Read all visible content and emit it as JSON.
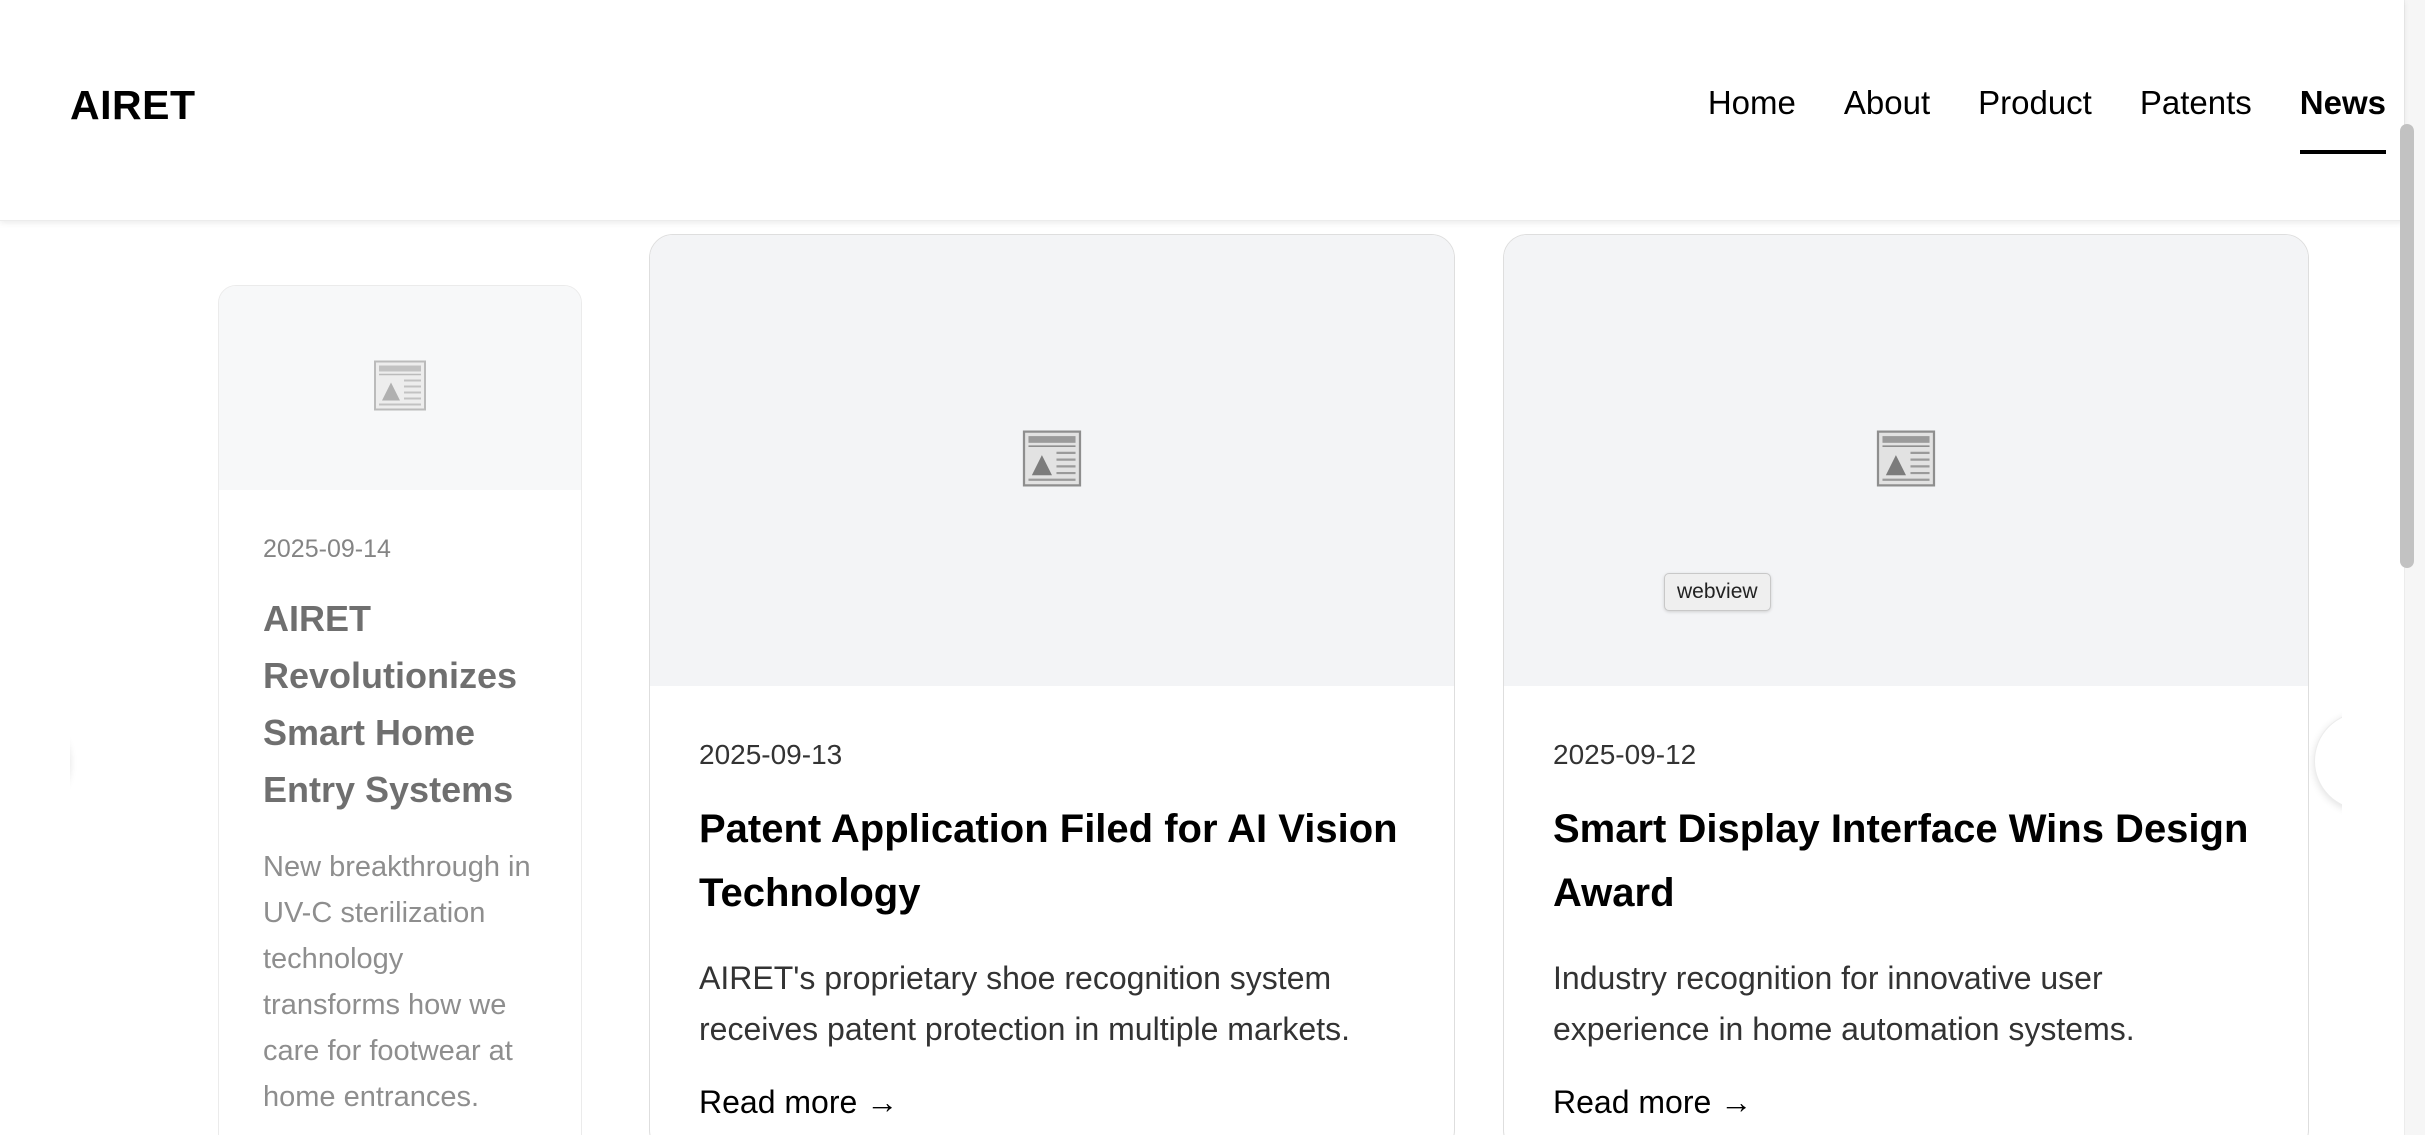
{
  "header": {
    "logo": "AIRET",
    "nav": [
      {
        "label": "Home",
        "active": false
      },
      {
        "label": "About",
        "active": false
      },
      {
        "label": "Product",
        "active": false
      },
      {
        "label": "Patents",
        "active": false
      },
      {
        "label": "News",
        "active": true
      }
    ]
  },
  "carousel": {
    "cards": [
      {
        "date": "2025-09-14",
        "title": "AIRET Revolutionizes Smart Home Entry Systems",
        "description": "New breakthrough in UV-C sterilization technology transforms how we care for footwear at home entrances.",
        "icon": "newspaper-icon"
      },
      {
        "date": "2025-09-13",
        "title": "Patent Application Filed for AI Vision Technology",
        "description": "AIRET's proprietary shoe recognition system receives patent protection in multiple markets.",
        "read_more": "Read more →",
        "icon": "newspaper-icon"
      },
      {
        "date": "2025-09-12",
        "title": "Smart Display Interface Wins Design Award",
        "description": "Industry recognition for innovative user experience in home automation systems.",
        "read_more": "Read more →",
        "icon": "newspaper-icon"
      }
    ]
  },
  "tooltip": "webview",
  "colors": {
    "text": "#000000",
    "media_background": "#f3f4f6",
    "card_border": "#dedede"
  }
}
